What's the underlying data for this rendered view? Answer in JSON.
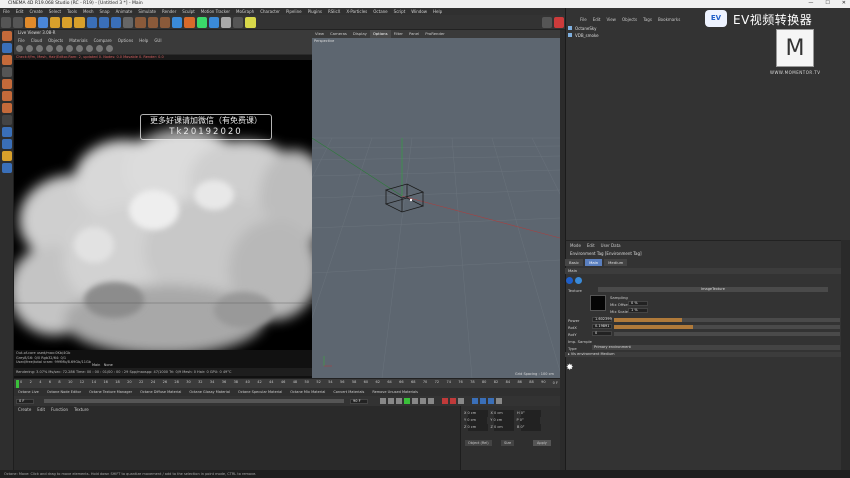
{
  "window": {
    "title": "CINEMA 4D R19.068 Studio (RC - R19) - [Untitled 3 *] - Main",
    "min_glyph": "—",
    "max_glyph": "☐",
    "close_glyph": "✕"
  },
  "menubar": [
    "File",
    "Edit",
    "Create",
    "Select",
    "Tools",
    "Mesh",
    "Snap",
    "Animate",
    "Simulate",
    "Render",
    "Sculpt",
    "Motion Tracker",
    "MoGraph",
    "Character",
    "Pipeline",
    "Plugins",
    "RSlicX",
    "X-Particles",
    "Octane",
    "Script",
    "Window",
    "Help"
  ],
  "live_viewer": {
    "title": "Live Viewer 3.08-R",
    "menu": [
      "File",
      "Cloud",
      "Objects",
      "Materials",
      "Compare",
      "Options",
      "Help",
      "GUI"
    ],
    "stat_line": "Check:f/fm, Mesh, Hair/Editor-Ram: 2, updated 0. Nodes: 0.0 Movable 0. Render: 0.0",
    "info": [
      "Out-of-core used/max:0Kb/4Gb",
      "Grey8/16: 0/0          Rgb32/64: 0/1",
      "Used/free/total vram: 999Mb/8.69Gb/11Gb"
    ],
    "main_label": "Main",
    "none_label": "None",
    "status": "Rendering: 3.07%   Ms/sec: 72.286   Time: 00 : 00 : 01/00 : 00 : 29   Spp/maxspp: 47/1000   Tri: 0/9   Mesh: 0   Hair: 0   GPU: 0   49°C"
  },
  "promo": {
    "line1": "更多好课请加微信（有免费课）",
    "line2": "Tk20192020"
  },
  "viewport": {
    "menu": [
      "View",
      "Cameras",
      "Display",
      "Options",
      "Filter",
      "Panel",
      "ProRender"
    ],
    "active_menu": "Options",
    "label": "Perspective",
    "grid_spacing": "Grid Spacing : 100 cm"
  },
  "timeline": {
    "ticks": [
      "0",
      "2",
      "4",
      "6",
      "8",
      "10",
      "12",
      "14",
      "16",
      "18",
      "20",
      "22",
      "24",
      "26",
      "28",
      "30",
      "32",
      "34",
      "36",
      "38",
      "40",
      "42",
      "44",
      "46",
      "48",
      "50",
      "52",
      "54",
      "56",
      "58",
      "60",
      "62",
      "64",
      "66",
      "68",
      "70",
      "72",
      "74",
      "76",
      "78",
      "80",
      "82",
      "84",
      "86",
      "88",
      "90"
    ],
    "frame_start": "0 F",
    "frame_end": "90 F",
    "current": "0 F"
  },
  "material_bar": [
    "Octane Live",
    "Octane Node Editor",
    "Octane Texture Manager",
    "Octane Diffuse Material",
    "Octane Glossy Material",
    "Octane Specular Material",
    "Octane Mix Material",
    "Convert Materials",
    "Remove Unused Materials"
  ],
  "material_panel": {
    "tabs": [
      "Create",
      "Edit",
      "Function",
      "Texture"
    ]
  },
  "coords": {
    "rows": [
      {
        "label": "X",
        "v1": "0 cm",
        "l2": "X",
        "v2": "0 cm",
        "l3": "H",
        "v3": "0°"
      },
      {
        "label": "Y",
        "v1": "0 cm",
        "l2": "Y",
        "v2": "0 cm",
        "l3": "P",
        "v3": "0°"
      },
      {
        "label": "Z",
        "v1": "0 cm",
        "l2": "Z",
        "v2": "0 cm",
        "l3": "B",
        "v3": "0°"
      }
    ],
    "object_rel": "Object (Rel)",
    "size": "Size",
    "apply": "Apply"
  },
  "status_bar": "Octane:    Move: Click and drag to move elements. Hold down SHIFT to quantize movement / add to the selection in point mode, CTRL to remove.",
  "objects": {
    "menu": [
      "File",
      "Edit",
      "View",
      "Objects",
      "Tags",
      "Bookmarks"
    ],
    "rows": [
      {
        "name": "OctaneSky"
      },
      {
        "name": "VDB_smoke"
      }
    ]
  },
  "attributes": {
    "menu": [
      "Mode",
      "Edit",
      "User Data"
    ],
    "title": "Environment Tag [Environment Tag]",
    "tabs": [
      "Basic",
      "Main",
      "Medium"
    ],
    "active_tab": "Main",
    "section": "Main",
    "texture_label": "Texture",
    "texture_value": "ImageTexture",
    "power_label": "Power",
    "power_value": "1.602399",
    "power_fill": 0.3,
    "rotx_label": "RotX",
    "rotx_value": "0.19891",
    "rotx_fill": 0.35,
    "roty_label": "RotY",
    "roty_value": "0",
    "roty_fill": 0.0,
    "importance_label": "Imp. Sample",
    "type_label": "Type",
    "type_value": "Primary environment",
    "vis_label": "▸ Vis environment Medium",
    "sampling_label": "Sampling",
    "mix_offset": "Mix Offset",
    "mix_offset_value": "0 %",
    "mix_scale": "Mix Scale",
    "mix_scale_value": "1 %"
  },
  "branding": {
    "ev_logo": "EV",
    "ev_text": "EV视频转换器",
    "m_logo": "M",
    "m_url": "WWW.MOMENTOR.TV"
  },
  "colors": {
    "accent_blue": "#5a7fbf",
    "bg": "#2b2b2b",
    "viewport": "#5d6670",
    "slider_fill": "#b07a3a"
  }
}
